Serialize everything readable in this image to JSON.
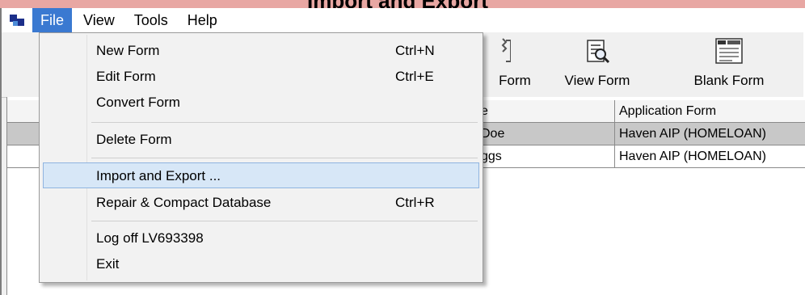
{
  "title_text": "Import and Export",
  "menubar": {
    "items": [
      {
        "label": "File"
      },
      {
        "label": "View"
      },
      {
        "label": "Tools"
      },
      {
        "label": "Help"
      }
    ]
  },
  "toolbar": {
    "buttons": [
      {
        "label": "Form",
        "icon": "edit-form-icon"
      },
      {
        "label": "View Form",
        "icon": "view-form-icon"
      },
      {
        "label": "Blank Form",
        "icon": "blank-form-icon"
      }
    ]
  },
  "table": {
    "headers": [
      "e",
      "Application Form"
    ],
    "rows": [
      [
        "Doe",
        "Haven AIP (HOMELOAN)"
      ],
      [
        "ggs",
        "Haven AIP (HOMELOAN)"
      ]
    ]
  },
  "file_menu": {
    "items": [
      {
        "label": "New Form",
        "shortcut": "Ctrl+N"
      },
      {
        "label": "Edit Form",
        "shortcut": "Ctrl+E"
      },
      {
        "label": "Convert Form",
        "shortcut": ""
      },
      {
        "label": "Delete Form",
        "shortcut": ""
      },
      {
        "label": "Import and Export ...",
        "shortcut": ""
      },
      {
        "label": "Repair & Compact Database",
        "shortcut": "Ctrl+R"
      },
      {
        "label": "Log off LV693398",
        "shortcut": ""
      },
      {
        "label": "Exit",
        "shortcut": ""
      }
    ]
  },
  "colors": {
    "menu_active": "#3a79d1",
    "highlight": "#d7e7f7",
    "title_strip": "#e8a7a3"
  }
}
